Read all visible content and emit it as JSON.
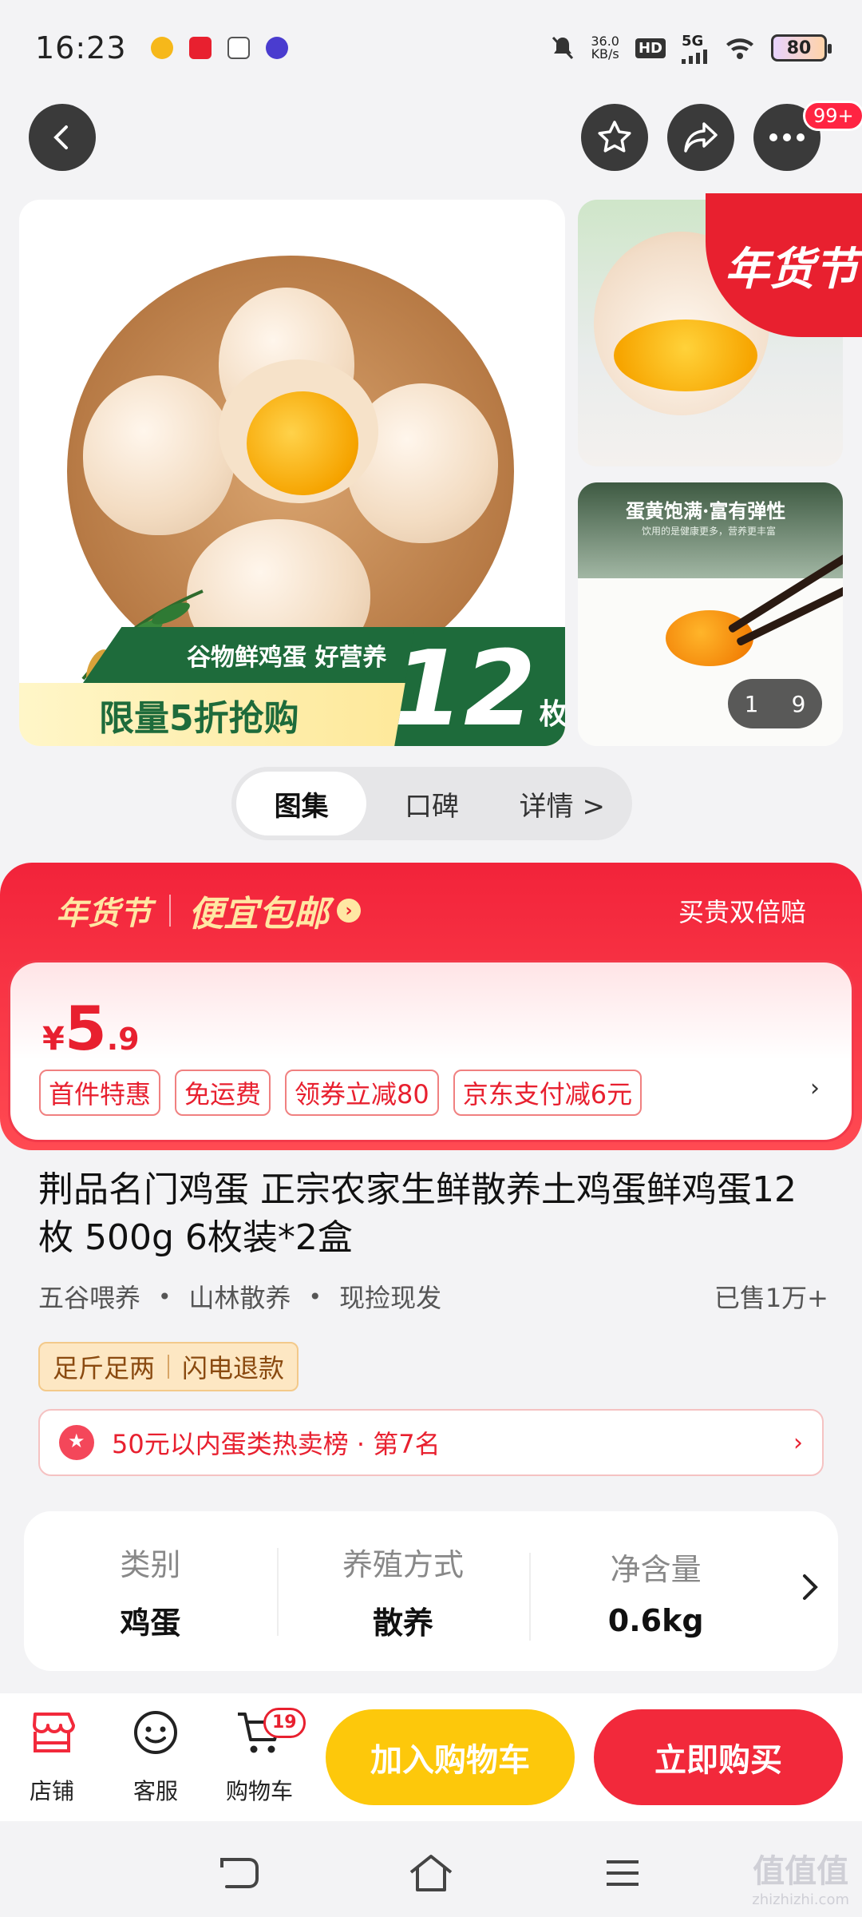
{
  "status": {
    "time": "16:23",
    "net_speed_value": "36.0",
    "net_speed_unit": "KB/s",
    "network": "5G",
    "battery": "80"
  },
  "top_nav": {
    "more_badge": "99+"
  },
  "gallery": {
    "main_banner_green": "谷物鲜鸡蛋 好营养",
    "main_banner_yellow": "限量5折抢购",
    "main_banner_count": "12",
    "main_banner_unit": "枚",
    "festival_badge": "年货节",
    "side2_title": "蛋黄饱满·富有弹性",
    "side2_sub": "饮用的是健康更多，营养更丰富",
    "counter_current": "1",
    "counter_total": "9"
  },
  "gallery_tabs": [
    {
      "label": "图集"
    },
    {
      "label": "口碑"
    },
    {
      "label": "详情 >"
    }
  ],
  "promo": {
    "festival": "年货节",
    "free_shipping": "便宜包邮",
    "guarantee": "买贵双倍赔",
    "price_symbol": "¥",
    "price_int": "5",
    "price_dec": ".9",
    "tags": [
      "首件特惠",
      "免运费",
      "领券立减80",
      "京东支付减6元"
    ],
    "tags_more": "›"
  },
  "product": {
    "title": "荆品名门鸡蛋 正宗农家生鲜散养土鸡蛋鲜鸡蛋12枚 500g 6枚装*2盒",
    "features": [
      "五谷喂养",
      "山林散养",
      "现捡现发"
    ],
    "sold": "已售1万+",
    "badges": [
      "足斤足两",
      "闪电退款"
    ],
    "rank": "50元以内蛋类热卖榜 · 第7名",
    "rank_chev": "›"
  },
  "specs": [
    {
      "label": "类别",
      "value": "鸡蛋"
    },
    {
      "label": "养殖方式",
      "value": "散养"
    },
    {
      "label": "净含量",
      "value": "0.6kg"
    }
  ],
  "bottom_bar": {
    "shop": "店铺",
    "service": "客服",
    "cart": "购物车",
    "cart_count": "19",
    "add_to_cart": "加入购物车",
    "buy_now": "立即购买"
  },
  "watermark": {
    "logo": "值值值",
    "site": "zhizhizhi.com"
  },
  "colors": {
    "brand_red": "#f2293b",
    "cart_yellow": "#fdc80b"
  }
}
